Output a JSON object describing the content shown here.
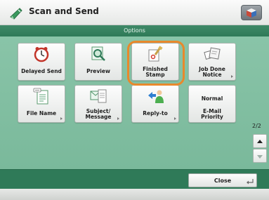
{
  "header": {
    "title": "Scan and Send",
    "app_icon": "scan-send-icon",
    "menu_icon": "cube-icon"
  },
  "options_bar": {
    "label": "Options"
  },
  "tiles": [
    {
      "label": "Delayed Send",
      "icon": "clock-icon"
    },
    {
      "label": "Preview",
      "icon": "magnifier-icon"
    },
    {
      "label_line1": "Finished",
      "label_line2": "Stamp",
      "icon": "stamp-icon",
      "highlighted": true
    },
    {
      "label_line1": "Job Done",
      "label_line2": "Notice",
      "icon": "notice-icon"
    },
    {
      "label": "File Name",
      "icon": "document-icon"
    },
    {
      "label_line1": "Subject/",
      "label_line2": "Message",
      "icon": "message-icon"
    },
    {
      "label": "Reply-to",
      "icon": "reply-person-icon"
    },
    {
      "label_top": "Normal",
      "label_line1": "E-Mail",
      "label_line2": "Priority"
    }
  ],
  "pager": {
    "text": "2/2"
  },
  "bottom": {
    "close_label": "Close"
  },
  "colors": {
    "panel": "#7ab99b",
    "bar": "#2f7a58",
    "highlight": "#e8892c"
  }
}
